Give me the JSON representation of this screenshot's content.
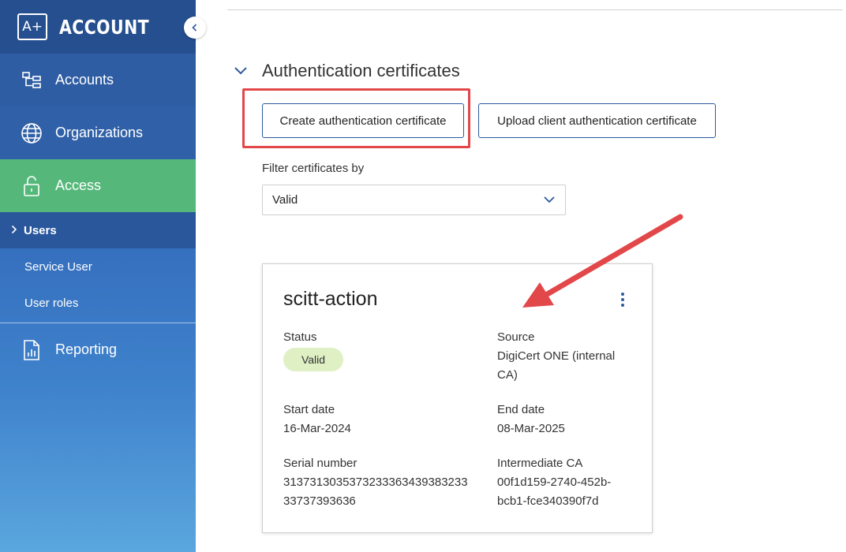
{
  "sidebar": {
    "brand": {
      "logo": "A+",
      "name": "ACCOUNT"
    },
    "items": [
      {
        "label": "Accounts",
        "icon": "hierarchy-icon"
      },
      {
        "label": "Organizations",
        "icon": "globe-icon"
      },
      {
        "label": "Access",
        "icon": "lock-icon",
        "active": true
      }
    ],
    "subitems": [
      {
        "label": "Users",
        "selected": true
      },
      {
        "label": "Service User"
      },
      {
        "label": "User roles"
      }
    ],
    "reporting": {
      "label": "Reporting",
      "icon": "report-icon"
    },
    "active_color": "#55b87a"
  },
  "main": {
    "section_title": "Authentication certificates",
    "buttons": {
      "create": "Create authentication certificate",
      "upload": "Upload client authentication certificate"
    },
    "filter": {
      "label": "Filter certificates by",
      "value": "Valid"
    },
    "certificate": {
      "name": "scitt-action",
      "status_label": "Status",
      "status_value": "Valid",
      "source_label": "Source",
      "source_value_line1": "DigiCert ONE (internal",
      "source_value_line2": "CA)",
      "start_label": "Start date",
      "start_value": "16-Mar-2024",
      "end_label": "End date",
      "end_value": "08-Mar-2025",
      "serial_label": "Serial number",
      "serial_line1": "3137313035373233363439383233",
      "serial_line2": "33737393636",
      "ica_label": "Intermediate CA",
      "ica_line1": "00f1d159-2740-452b-",
      "ica_line2": "bcb1-fce340390f7d"
    }
  },
  "annotations": {
    "highlight_color": "#e2474a"
  }
}
